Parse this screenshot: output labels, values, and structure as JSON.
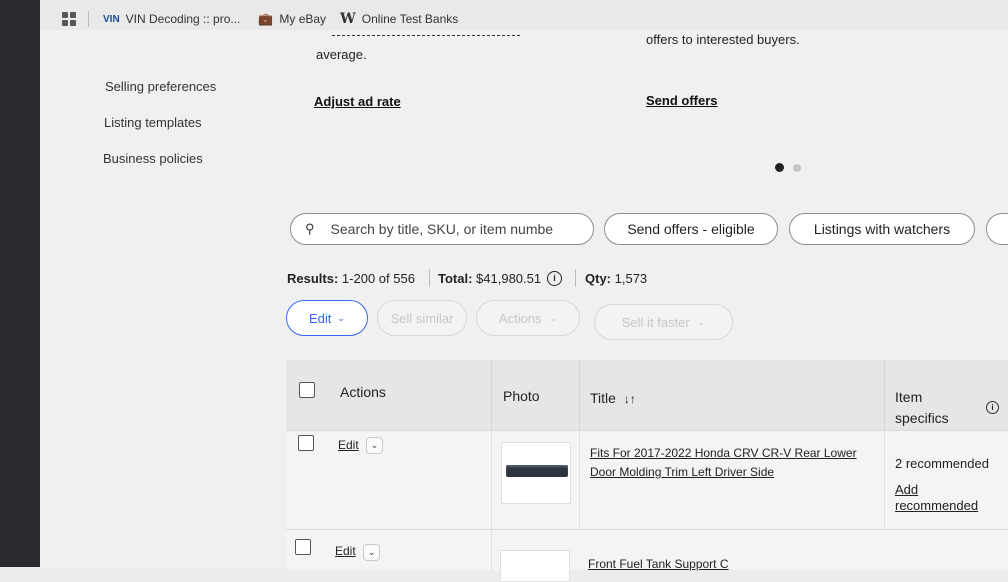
{
  "bookmarks": {
    "items": [
      {
        "label": "VIN Decoding :: pro...",
        "icon": "vin-icon"
      },
      {
        "label": "My eBay",
        "icon": "briefcase-icon"
      },
      {
        "label": "Online Test Banks",
        "icon": "w-logo-icon"
      }
    ]
  },
  "sidebar": {
    "items": [
      "Selling preferences",
      "Listing templates",
      "Business policies"
    ]
  },
  "promo": {
    "left_text": "average.",
    "right_text": "offers to interested buyers.",
    "left_link": "Adjust ad rate",
    "right_link": "Send offers"
  },
  "search": {
    "placeholder": "Search by title, SKU, or item numbe"
  },
  "filters": [
    "Send offers - eligible",
    "Listings with watchers"
  ],
  "results": {
    "results_label": "Results:",
    "results_value": "1-200 of 556",
    "total_label": "Total:",
    "total_value": "$41,980.51",
    "qty_label": "Qty:",
    "qty_value": "1,573"
  },
  "toolbar": {
    "edit": "Edit",
    "sell_similar": "Sell similar",
    "actions": "Actions",
    "sell_it_faster": "Sell it faster"
  },
  "table": {
    "headers": {
      "actions": "Actions",
      "photo": "Photo",
      "title": "Title",
      "item_specifics_1": "Item",
      "item_specifics_2": "specifics"
    },
    "rows": [
      {
        "edit": "Edit",
        "title_line1": "Fits For 2017-2022 Honda CRV CR-V Rear Lower",
        "title_line2": "Door Molding Trim Left Driver Side",
        "specifics": "2 recommended",
        "add_line1": "Add",
        "add_line2": "recommended"
      },
      {
        "edit": "Edit",
        "title_line1": "Front Fuel Tank Support C"
      }
    ]
  },
  "colors": {
    "accent": "#3665f3"
  }
}
